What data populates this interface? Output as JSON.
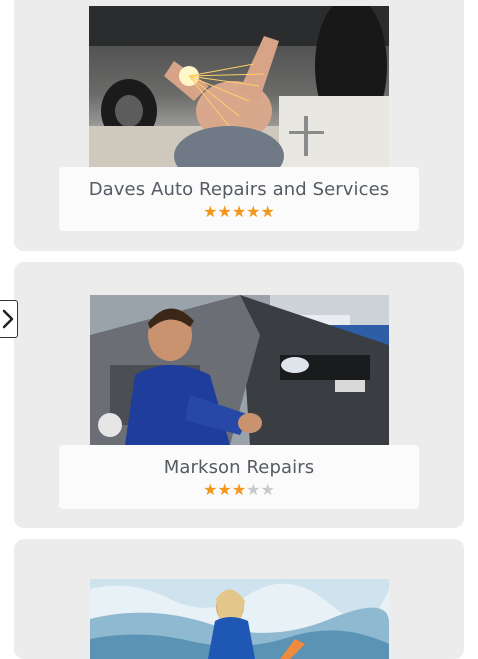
{
  "listings": [
    {
      "name": "Daves Auto Repairs and Services",
      "rating": 5,
      "max_rating": 5,
      "photo": "mechanic-welding-under-car"
    },
    {
      "name": "Markson Repairs",
      "rating": 3,
      "max_rating": 5,
      "photo": "smiling-mechanic-engine-bay"
    },
    {
      "name": "",
      "rating": null,
      "max_rating": 5,
      "photo": "surfer-on-wave"
    }
  ],
  "nav": {
    "next_icon": "chevron-right-icon"
  },
  "colors": {
    "star_on": "#f3961c",
    "star_off": "#c9c9c9",
    "card_bg": "#ececec",
    "title_text": "#555b63"
  }
}
